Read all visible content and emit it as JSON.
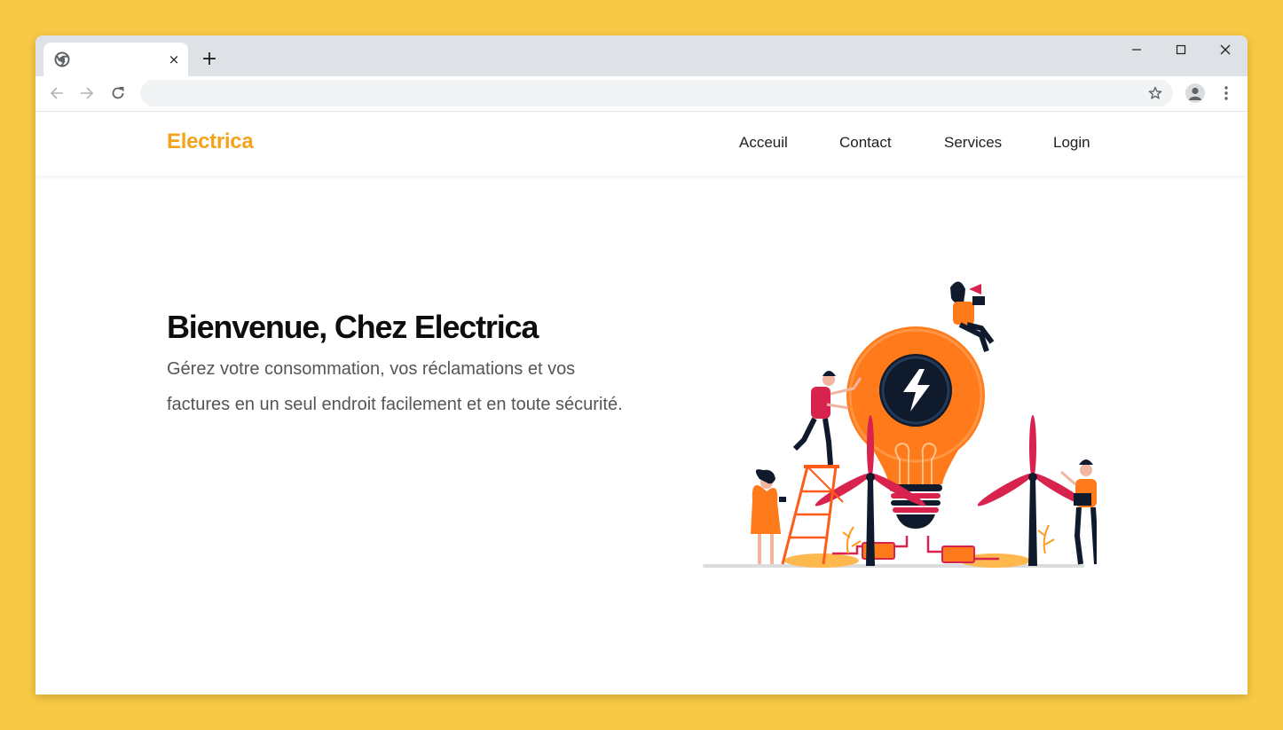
{
  "browser": {
    "tab": {
      "title": "",
      "favicon": "chrome-icon",
      "close_label": "×"
    },
    "new_tab_label": "+",
    "window_controls": [
      "minimize-icon",
      "maximize-icon",
      "close-icon"
    ],
    "toolbar": {
      "icons": [
        "back-arrow-icon",
        "forward-arrow-icon",
        "reload-icon",
        "star-icon",
        "profile-avatar-icon",
        "more-menu-icon"
      ],
      "address_value": ""
    }
  },
  "site": {
    "brand": "Electrica",
    "brand_color": "#f5a31a",
    "nav": [
      {
        "label": "Acceuil"
      },
      {
        "label": "Contact"
      },
      {
        "label": "Services"
      },
      {
        "label": "Login"
      }
    ],
    "hero": {
      "title": "Bienvenue, Chez Electrica",
      "text": "Gérez votre consommation, vos réclamations et vos factures en un seul endroit facilement et en toute sécurité.",
      "illustration": "lightbulb-wind-turbines-illustration"
    }
  },
  "colors": {
    "page_background": "#f8c945",
    "accent": "#f5a31a",
    "bulb_orange": "#ff7a1a",
    "dark": "#0f1b2d"
  }
}
